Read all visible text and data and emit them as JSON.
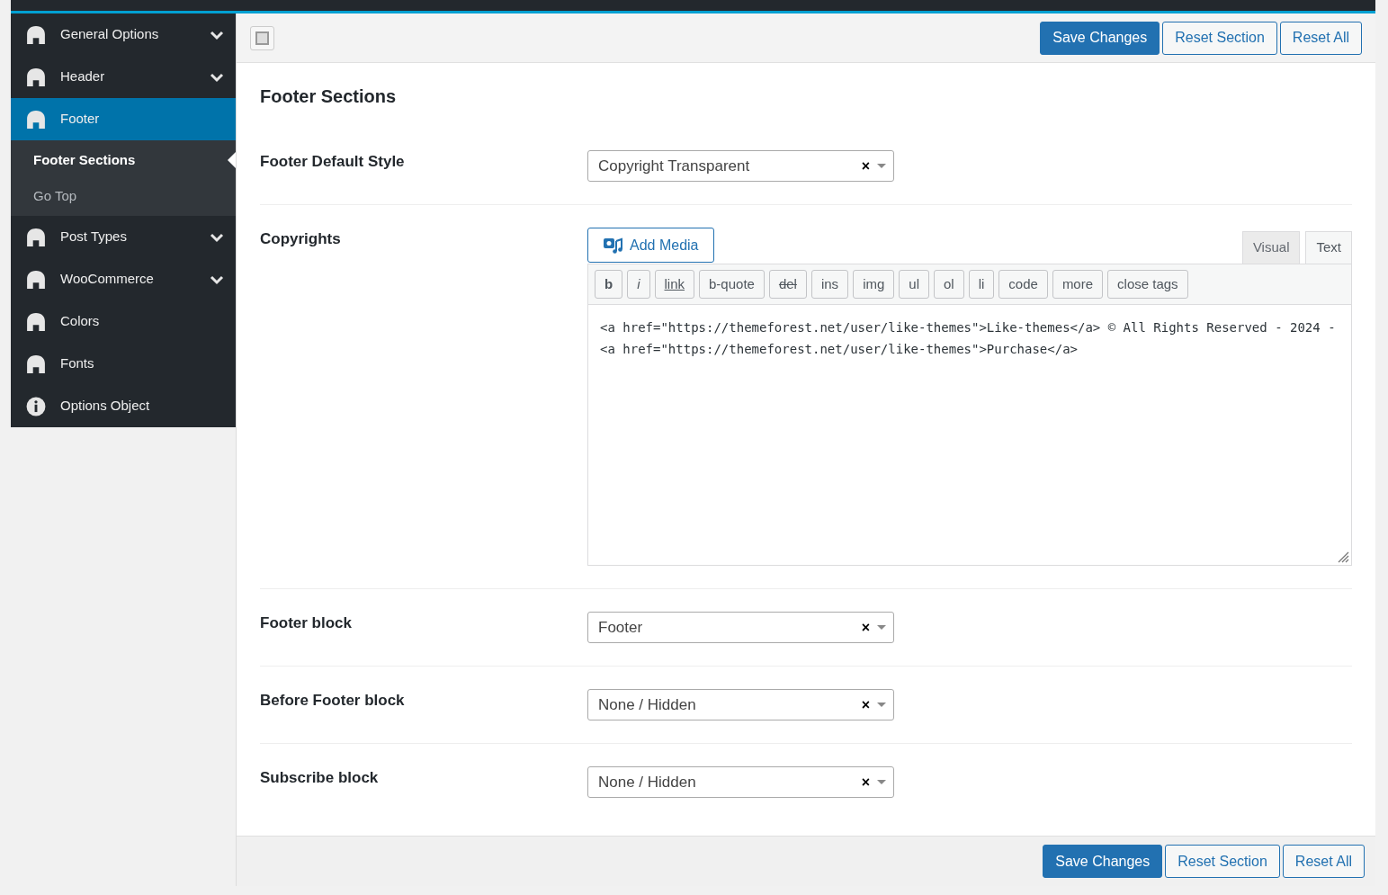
{
  "sidebar": {
    "items": [
      {
        "label": "General Options",
        "kind": "expandable",
        "selected": false
      },
      {
        "label": "Header",
        "kind": "expandable",
        "selected": false
      },
      {
        "label": "Footer",
        "kind": "page",
        "selected": true,
        "children": [
          {
            "label": "Footer Sections",
            "selected": true
          },
          {
            "label": "Go Top",
            "selected": false
          }
        ]
      },
      {
        "label": "Post Types",
        "kind": "expandable",
        "selected": false
      },
      {
        "label": "WooCommerce",
        "kind": "expandable",
        "selected": false
      },
      {
        "label": "Colors",
        "kind": "page",
        "selected": false
      },
      {
        "label": "Fonts",
        "kind": "page",
        "selected": false
      },
      {
        "label": "Options Object",
        "kind": "info",
        "selected": false
      }
    ]
  },
  "top_buttons": [
    {
      "label": "Save Changes",
      "kind": "primary"
    },
    {
      "label": "Reset Section",
      "kind": "secondary"
    },
    {
      "label": "Reset All",
      "kind": "secondary"
    }
  ],
  "section_title": "Footer Sections",
  "fields": [
    {
      "kind": "select",
      "label": "Footer Default Style",
      "value": "Copyright Transparent",
      "clear": "×"
    },
    {
      "kind": "editor",
      "label": "Copyrights",
      "add_media": "Add Media",
      "tabs": [
        {
          "label": "Visual",
          "selected": false
        },
        {
          "label": "Text",
          "selected": true
        }
      ],
      "quicktags": [
        "b",
        "i",
        "link",
        "b-quote",
        "del",
        "ins",
        "img",
        "ul",
        "ol",
        "li",
        "code",
        "more",
        "close tags"
      ],
      "content": "<a href=\"https://themeforest.net/user/like-themes\">Like-themes</a> © All Rights Reserved - 2024 - <a href=\"https://themeforest.net/user/like-themes\">Purchase</a>"
    },
    {
      "kind": "select",
      "label": "Footer block",
      "value": "Footer",
      "clear": "×"
    },
    {
      "kind": "select",
      "label": "Before Footer block",
      "value": "None / Hidden",
      "clear": "×"
    },
    {
      "kind": "select",
      "label": "Subscribe block",
      "value": "None / Hidden",
      "clear": "×"
    }
  ],
  "bottom_buttons": [
    {
      "label": "Save Changes",
      "kind": "primary"
    },
    {
      "label": "Reset Section",
      "kind": "secondary"
    },
    {
      "label": "Reset All",
      "kind": "secondary"
    }
  ]
}
